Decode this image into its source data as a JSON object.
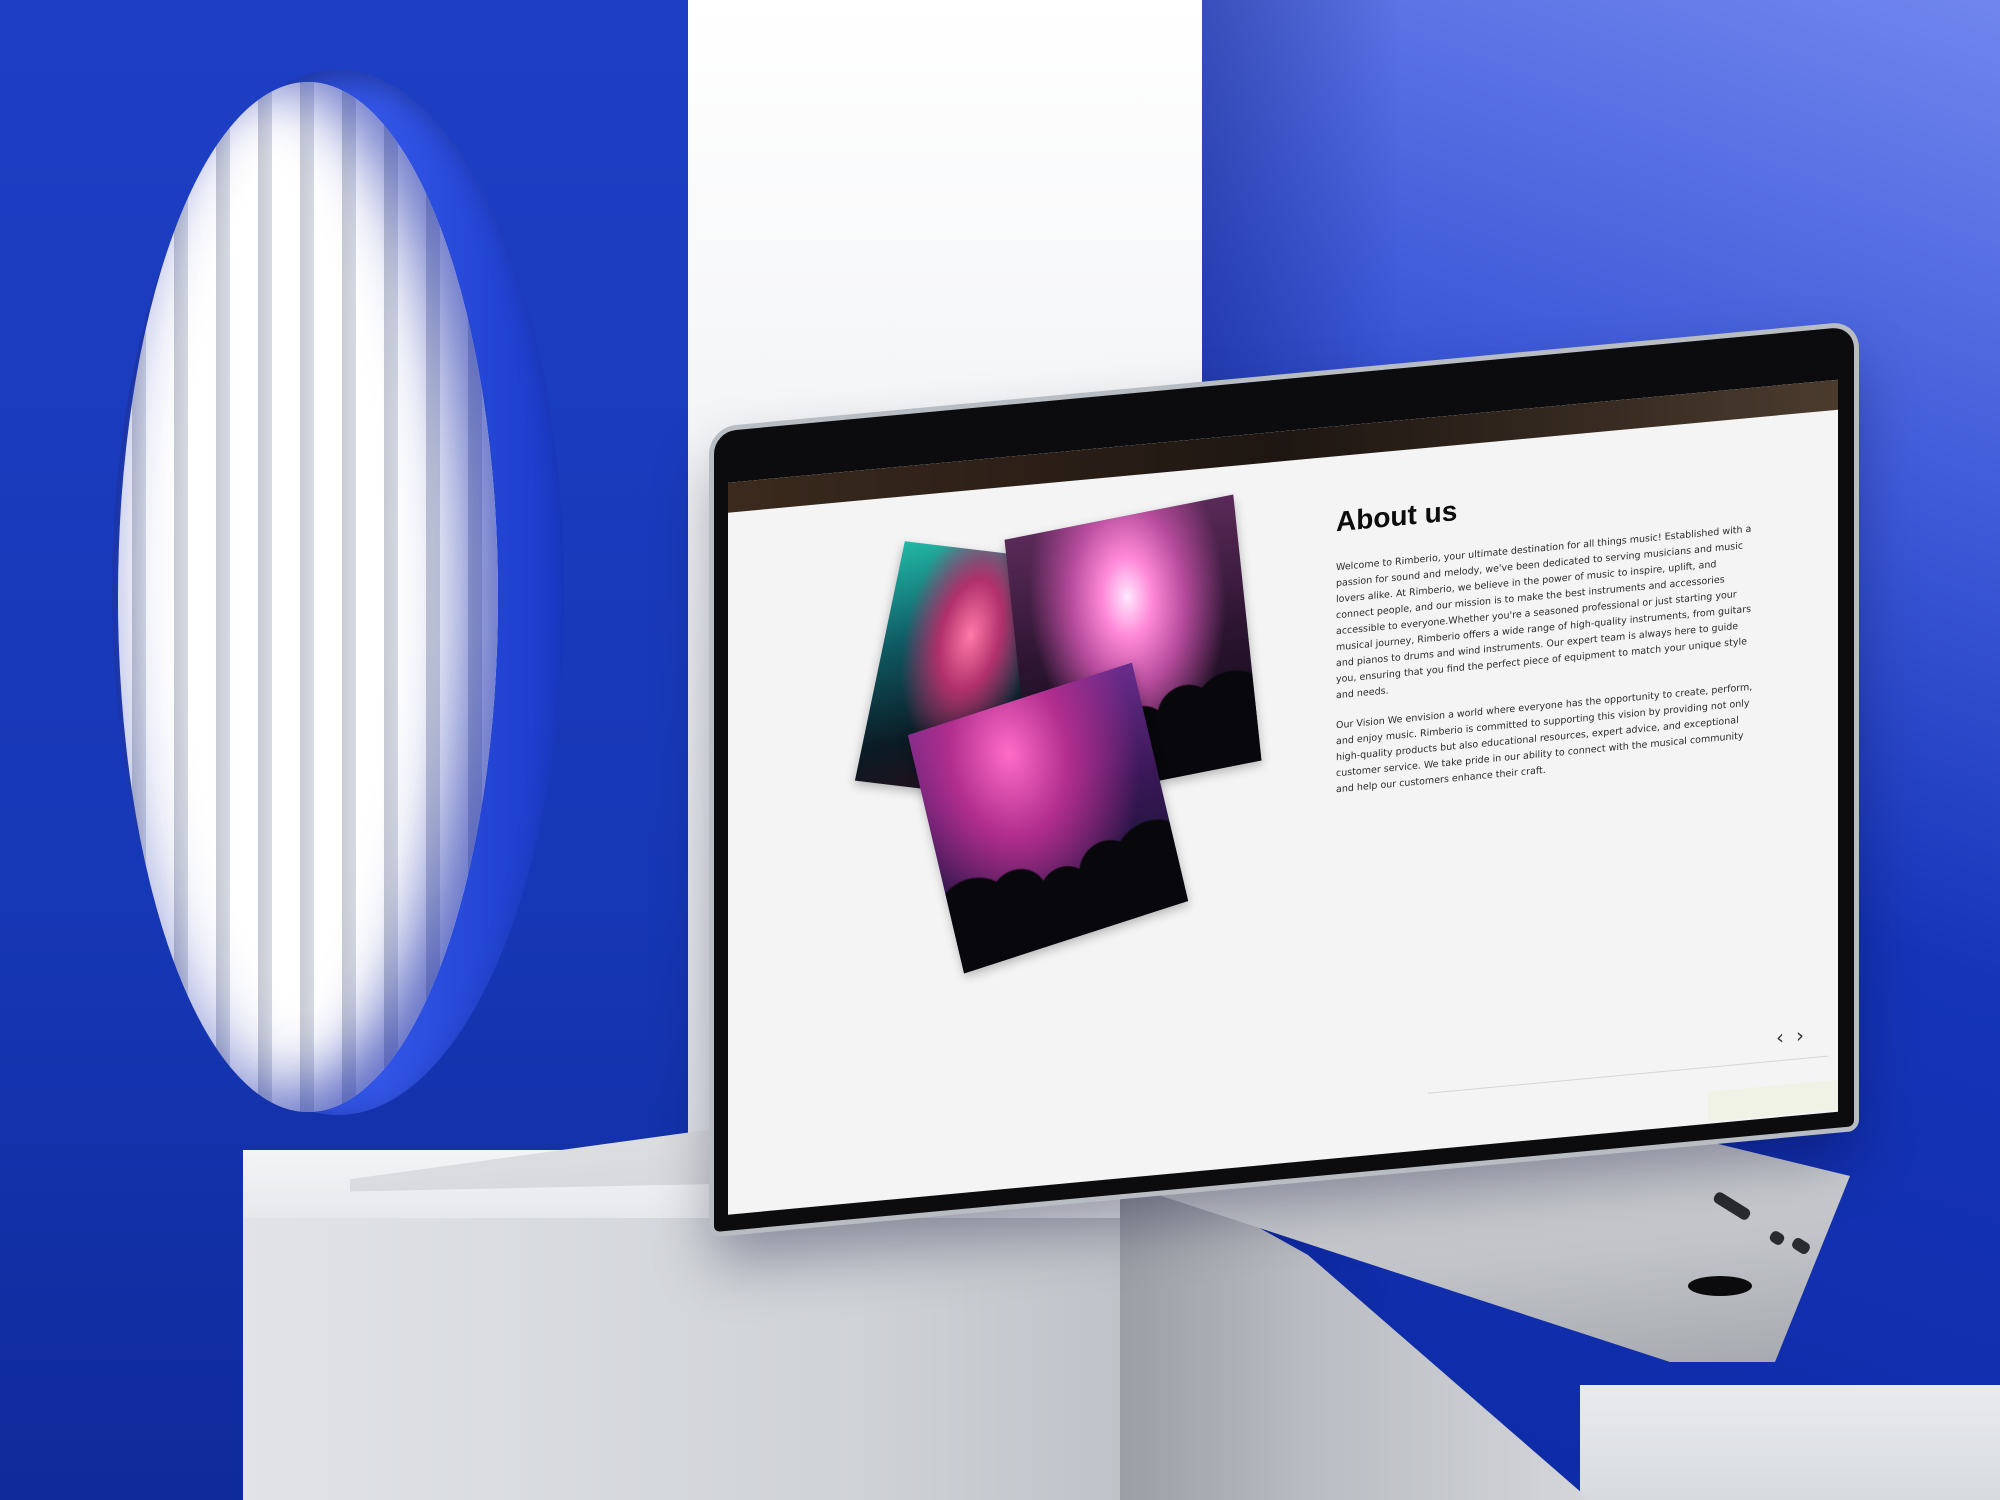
{
  "about": {
    "title": "About us",
    "paragraph_1": "Welcome to Rimberio, your ultimate destination for all things music! Established with a passion for sound and melody, we've been dedicated to serving musicians and music lovers alike. At Rimberio, we believe in the power of music to inspire, uplift, and connect people, and our mission is to make the best instruments and accessories accessible to everyone.Whether you're a seasoned professional or just starting your musical journey, Rimberio offers a wide range of high-quality instruments, from guitars and pianos to drums and wind instruments. Our expert team is always here to guide you, ensuring that you find the perfect piece of equipment to match your unique style and needs.",
    "paragraph_2": "Our Vision We envision a world where everyone has the opportunity to create, perform, and enjoy music. Rimberio is committed to supporting this vision by providing not only high-quality products but also educational resources, expert advice, and exceptional customer service. We take pride in our ability to connect with the musical community and help our customers enhance their craft."
  },
  "carousel": {
    "prev_icon": "‹",
    "next_icon": "›"
  },
  "colors": {
    "backdrop_blue": "#1a3bc0",
    "screen_bg": "#f4f4f5",
    "heading": "#0d0d0d"
  },
  "icons": {
    "prev": "chevron-left-icon",
    "next": "chevron-right-icon"
  }
}
